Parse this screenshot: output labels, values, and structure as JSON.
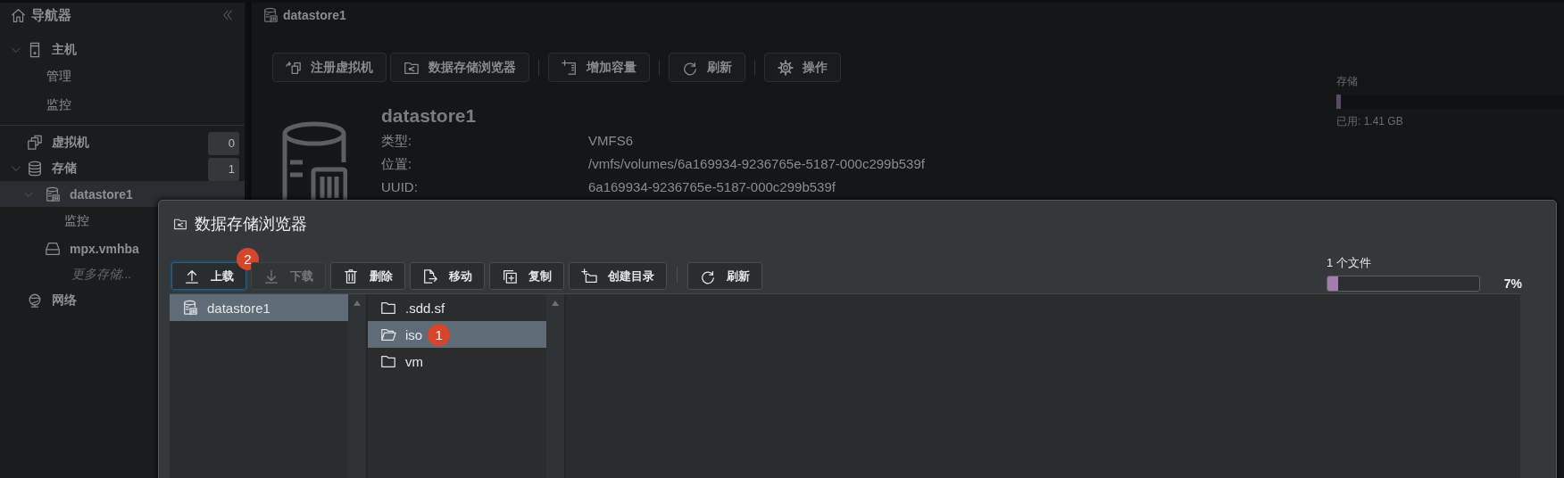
{
  "navigator": {
    "title": "导航器",
    "items": [
      {
        "label": "主机",
        "kind": "host",
        "expanded": true,
        "children": [
          {
            "label": "管理",
            "kind": "link"
          },
          {
            "label": "监控",
            "kind": "link"
          }
        ]
      },
      {
        "label": "虚拟机",
        "kind": "vm",
        "count": "0"
      },
      {
        "label": "存储",
        "kind": "storage",
        "expanded": true,
        "count": "1",
        "children": [
          {
            "label": "datastore1",
            "kind": "datastore",
            "expanded": true,
            "selected": true,
            "children": [
              {
                "label": "监控",
                "kind": "link"
              }
            ]
          },
          {
            "label": "mpx.vmhba",
            "kind": "disk",
            "selected": false
          },
          {
            "label": "更多存储...",
            "kind": "more"
          }
        ]
      },
      {
        "label": "网络",
        "kind": "network"
      }
    ]
  },
  "main": {
    "title": "datastore1",
    "toolbar": [
      [
        {
          "label": "注册虚拟机",
          "kind": "register"
        },
        {
          "label": "数据存储浏览器",
          "kind": "browser"
        }
      ],
      [
        {
          "label": "增加容量",
          "kind": "grow"
        }
      ],
      [
        {
          "label": "刷新",
          "kind": "refresh"
        }
      ],
      [
        {
          "label": "操作",
          "kind": "gear"
        }
      ]
    ],
    "name": "datastore1",
    "details": [
      {
        "label": "类型:",
        "value": "VMFS6"
      },
      {
        "label": "位置:",
        "value": "/vmfs/volumes/6a169934-9236765e-5187-000c299b539f"
      },
      {
        "label": "UUID:",
        "value": "6a169934-9236765e-5187-000c299b539f"
      }
    ],
    "storage": {
      "label": "存储",
      "level": 0.02,
      "used": "已用: 1.41 GB"
    }
  },
  "dialog": {
    "title": "数据存储浏览器",
    "toolbar": [
      [
        {
          "label": "上载",
          "kind": "upload",
          "disabled": false,
          "focused": true,
          "badge": "2"
        },
        {
          "label": "下载",
          "kind": "download",
          "disabled": true,
          "focused": false
        },
        {
          "label": "删除",
          "kind": "delete",
          "disabled": false,
          "focused": false
        },
        {
          "label": "移动",
          "kind": "move",
          "disabled": false,
          "focused": false
        },
        {
          "label": "复制",
          "kind": "copy",
          "disabled": false,
          "focused": false
        },
        {
          "label": "创建目录",
          "kind": "newfolder",
          "disabled": false,
          "focused": false
        }
      ],
      [
        {
          "label": "刷新",
          "kind": "refresh",
          "disabled": false,
          "focused": false
        }
      ]
    ],
    "progress": {
      "label": "1 个文件",
      "level": 0.07,
      "percent": "7%"
    },
    "columns": [
      {
        "items": [
          {
            "name": "datastore1",
            "kind": "datastore",
            "selected": true
          }
        ]
      },
      {
        "items": [
          {
            "name": ".sdd.sf",
            "kind": "folder",
            "selected": false
          },
          {
            "name": "iso",
            "kind": "folder",
            "selected": true,
            "badge": "1"
          },
          {
            "name": "vm",
            "kind": "folder",
            "selected": false
          }
        ]
      }
    ]
  }
}
